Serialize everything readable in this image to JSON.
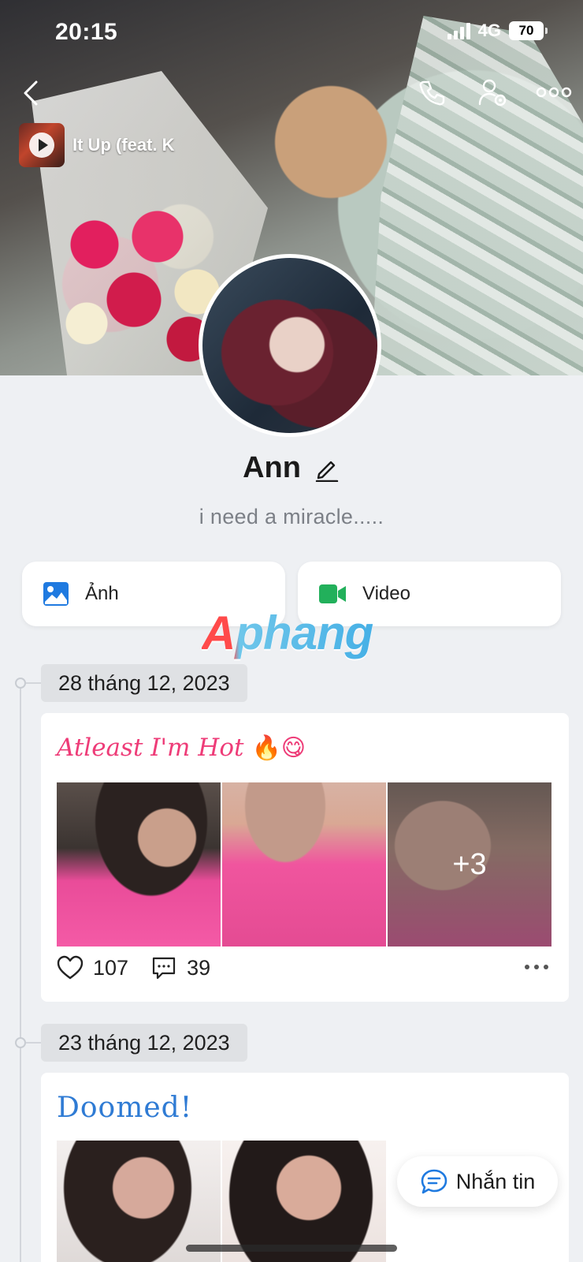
{
  "status_bar": {
    "time": "20:15",
    "network": "4G",
    "battery": "70"
  },
  "music": {
    "title": "It Up (feat. K"
  },
  "profile": {
    "name": "Ann",
    "bio": "i need a miracle....."
  },
  "tabs": [
    {
      "label": "Ảnh"
    },
    {
      "label": "Video"
    }
  ],
  "watermark": "Aphang",
  "posts": [
    {
      "date": "28 tháng 12, 2023",
      "caption": "Atleast I'm Hot",
      "emoji": "🔥😋",
      "extra_photos": "+3",
      "likes": "107",
      "comments": "39"
    },
    {
      "date": "23 tháng 12, 2023",
      "caption": "Doomed!"
    }
  ],
  "message_button": {
    "label": "Nhắn tin"
  },
  "colors": {
    "caption_hot": "#ee3c78",
    "caption_doomed": "#2f7bd4",
    "photo_icon": "#1f7ae0",
    "video_icon": "#22b05b"
  }
}
